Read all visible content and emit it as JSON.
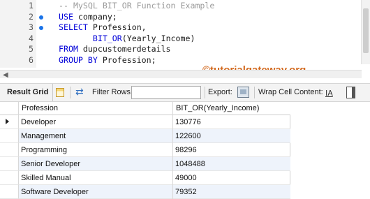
{
  "editor": {
    "lines": [
      {
        "num": "1",
        "marker": false,
        "parts": [
          {
            "t": "-- MySQL BIT_OR Function Example",
            "c": "cm"
          }
        ]
      },
      {
        "num": "2",
        "marker": true,
        "parts": [
          {
            "t": "USE",
            "c": "kw"
          },
          {
            "t": " company;",
            "c": "tx"
          }
        ]
      },
      {
        "num": "3",
        "marker": true,
        "parts": [
          {
            "t": "SELECT",
            "c": "kw"
          },
          {
            "t": " Profession,",
            "c": "tx"
          }
        ]
      },
      {
        "num": "4",
        "marker": false,
        "parts": [
          {
            "t": "       ",
            "c": "tx"
          },
          {
            "t": "BIT_OR",
            "c": "kw"
          },
          {
            "t": "(Yearly_Income)",
            "c": "tx"
          }
        ]
      },
      {
        "num": "5",
        "marker": false,
        "parts": [
          {
            "t": "FROM",
            "c": "kw"
          },
          {
            "t": " dupcustomerdetails",
            "c": "tx"
          }
        ]
      },
      {
        "num": "6",
        "marker": false,
        "parts": [
          {
            "t": "GROUP BY",
            "c": "kw"
          },
          {
            "t": " Profession;",
            "c": "tx"
          }
        ]
      }
    ]
  },
  "watermark": "©tutorialgateway.org",
  "toolbar": {
    "result_grid_label": "Result Grid",
    "filter_rows_label": "Filter Rows:",
    "filter_value": "",
    "export_label": "Export:",
    "wrap_label": "Wrap Cell Content:",
    "wrap_icon_glyph": "IA"
  },
  "grid": {
    "columns": [
      "Profession",
      "BIT_OR(Yearly_Income)"
    ],
    "rows": [
      [
        "Developer",
        "130776"
      ],
      [
        "Management",
        "122600"
      ],
      [
        "Programming",
        "98296"
      ],
      [
        "Senior Developer",
        "1048488"
      ],
      [
        "Skilled Manual",
        "49000"
      ],
      [
        "Software Developer",
        "79352"
      ]
    ]
  },
  "colors": {
    "keyword": "#0000d8",
    "comment": "#9a9a9a",
    "watermark": "#d2691e",
    "alt_row": "#eef3fb"
  }
}
